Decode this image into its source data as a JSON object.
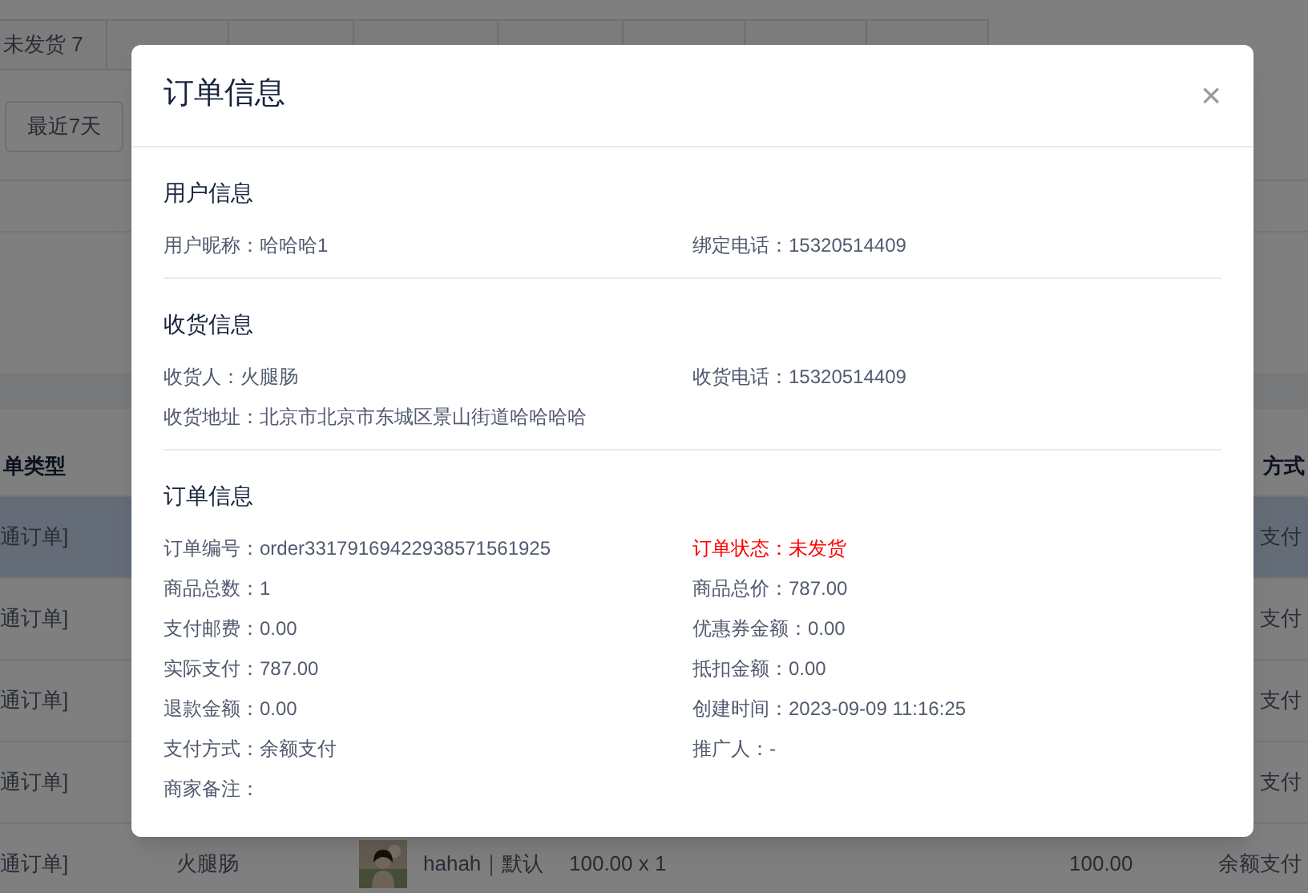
{
  "tabs": [
    {
      "label": "未发货 7"
    }
  ],
  "filter": {
    "button": "最近7天"
  },
  "table": {
    "columns": [
      "单类型",
      "方式"
    ],
    "rows": [
      {
        "selected": true,
        "type": "通订单]",
        "payment": "支付"
      },
      {
        "selected": false,
        "type": "通订单]",
        "payment": "支付"
      },
      {
        "selected": false,
        "type": "通订单]",
        "payment": "支付"
      },
      {
        "selected": false,
        "type": "通订单]",
        "payment": "支付"
      },
      {
        "selected": false,
        "type": "通订单]",
        "receiver": "火腿肠",
        "product": "hahah｜默认",
        "price": "100.00 x 1",
        "amount": "100.00",
        "payment": "余额支付"
      }
    ]
  },
  "dialog": {
    "title": "订单信息",
    "close": "×",
    "sections": [
      {
        "title": "用户信息",
        "fields": [
          {
            "kind": "text",
            "text": "用户昵称：哈哈哈1"
          },
          {
            "kind": "text",
            "text": "绑定电话：15320514409"
          }
        ]
      },
      {
        "title": "收货信息",
        "fields": [
          {
            "kind": "text",
            "text": "收货人：火腿肠"
          },
          {
            "kind": "text",
            "text": "收货电话：15320514409"
          },
          {
            "kind": "text",
            "text": "收货地址：北京市北京市东城区景山街道哈哈哈哈"
          }
        ]
      },
      {
        "title": "订单信息",
        "fields": [
          {
            "kind": "text",
            "text": "订单编号：order33179169422938571561925"
          },
          {
            "kind": "status",
            "text": "订单状态：未发货"
          },
          {
            "kind": "text",
            "text": "商品总数：1"
          },
          {
            "kind": "text",
            "text": "商品总价：787.00"
          },
          {
            "kind": "text",
            "text": "支付邮费：0.00"
          },
          {
            "kind": "text",
            "text": "优惠券金额：0.00"
          },
          {
            "kind": "text",
            "text": "实际支付：787.00"
          },
          {
            "kind": "text",
            "text": "抵扣金额：0.00"
          },
          {
            "kind": "text",
            "text": "退款金额：0.00"
          },
          {
            "kind": "text",
            "text": "创建时间：2023-09-09 11:16:25"
          },
          {
            "kind": "text",
            "text": "支付方式：余额支付"
          },
          {
            "kind": "text",
            "text": "推广人：-"
          },
          {
            "kind": "text",
            "text": "商家备注："
          }
        ]
      }
    ]
  }
}
